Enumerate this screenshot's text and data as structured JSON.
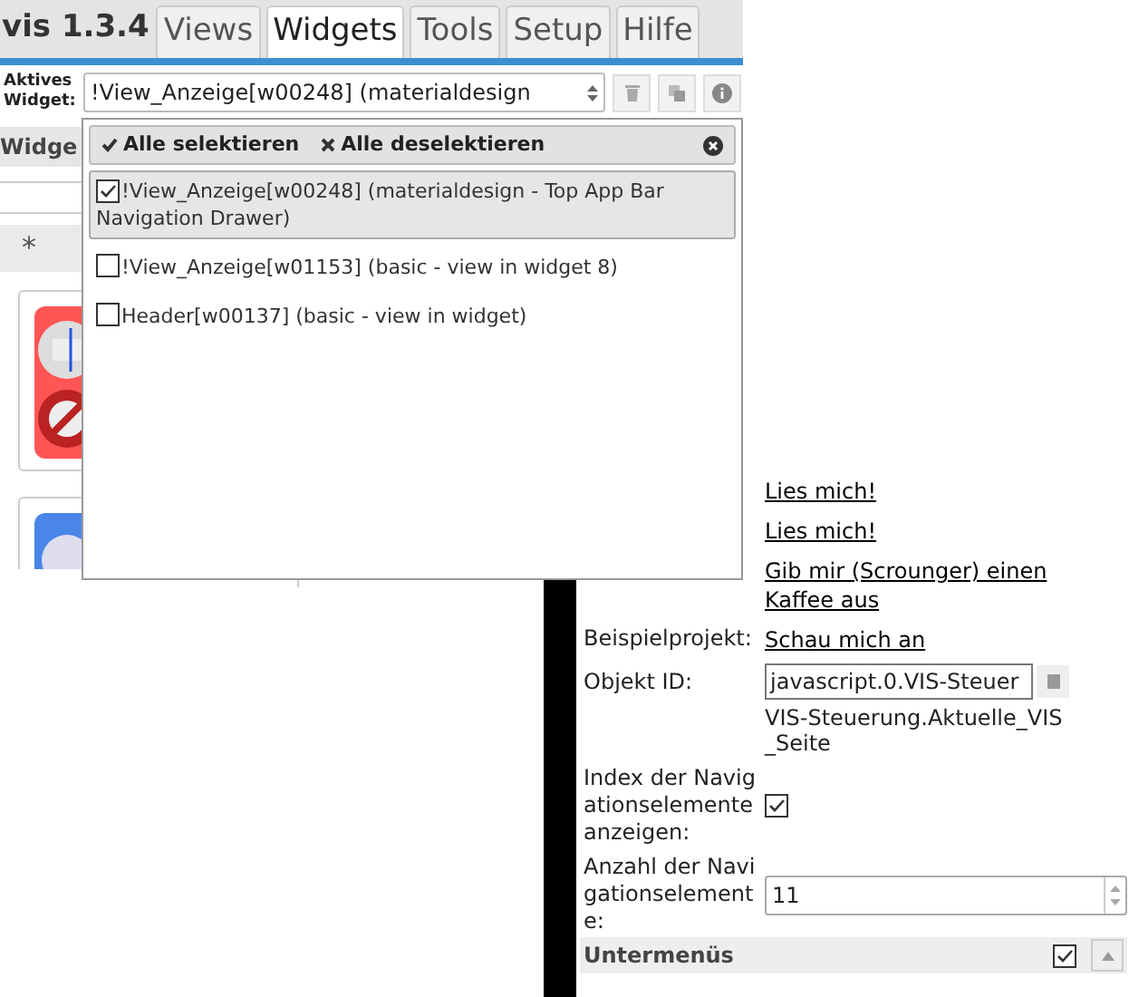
{
  "app": {
    "title": "vis 1.3.4"
  },
  "tabs": [
    {
      "label": "Views",
      "selected": false
    },
    {
      "label": "Widgets",
      "selected": true
    },
    {
      "label": "Tools",
      "selected": false
    },
    {
      "label": "Setup",
      "selected": false
    },
    {
      "label": "Hilfe",
      "selected": false
    }
  ],
  "active_widget": {
    "label": "Aktives Widget:",
    "value": "!View_Anzeige[w00248] (materialdesign"
  },
  "widget_panel": {
    "title": "Widge",
    "filter": "*"
  },
  "dropdown": {
    "select_all": "Alle selektieren",
    "deselect_all": "Alle deselektieren",
    "items": [
      {
        "label": "!View_Anzeige[w00248] (materialdesign - Top App Bar Navigation Drawer)",
        "checked": true,
        "selected": true
      },
      {
        "label": "!View_Anzeige[w01153] (basic - view in widget 8)",
        "checked": false,
        "selected": false
      },
      {
        "label": "Header[w00137] (basic - view in widget)",
        "checked": false,
        "selected": false
      }
    ]
  },
  "properties": {
    "rows": [
      {
        "kind": "link",
        "value": "Lies mich!"
      },
      {
        "kind": "link",
        "value": "Lies mich!"
      },
      {
        "kind": "link",
        "value": "Gib mir (Scrounger) einen Kaffee aus"
      },
      {
        "kind": "link",
        "label": "Beispielprojekt:",
        "value": "Schau mich an"
      },
      {
        "kind": "id",
        "label": "Objekt ID:",
        "value": "javascript.0.VIS-Steuer",
        "note": "VIS-Steuerung.Aktuelle_VIS_Seite"
      },
      {
        "kind": "checkbox",
        "label": "Index der Navigationselemente anzeigen:",
        "checked": true
      },
      {
        "kind": "number",
        "label": "Anzahl der Navigationselemente:",
        "value": "11"
      },
      {
        "kind": "group",
        "label": "Untermenüs",
        "checked": true
      }
    ]
  }
}
